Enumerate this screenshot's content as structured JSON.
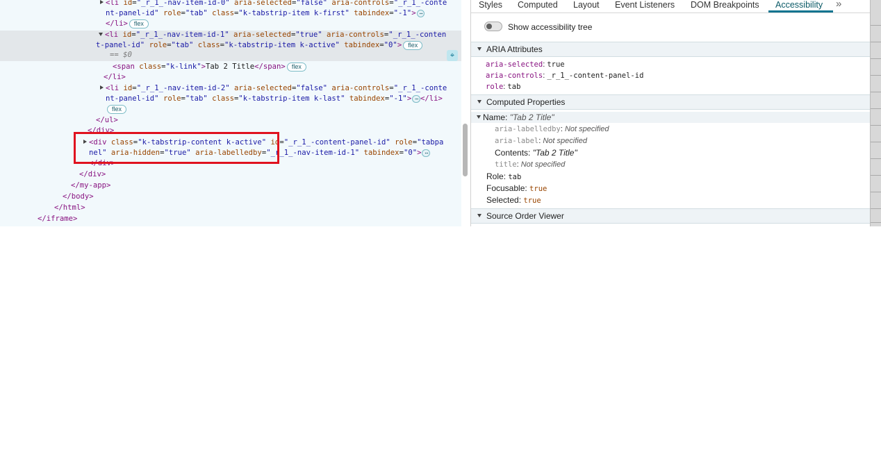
{
  "elements": {
    "lines": [
      {
        "pre": "<li id=\"_r_1_-nav-item-id-0\" aria-selected=\"false\" aria-controls=\"_r_1_-conte"
      },
      {
        "pre": "nt-panel-id\" role=\"tab\" class=\"k-tabstrip-item k-first\" tabindex=\"-1\">"
      },
      {
        "pre": "</li>"
      },
      {
        "pre": "<li id=\"_r_1_-nav-item-id-1\" aria-selected=\"true\" aria-controls=\"_r_1_-conten"
      },
      {
        "pre": "t-panel-id\" role=\"tab\" class=\"k-tabstrip-item k-active\" tabindex=\"0\">"
      },
      {
        "pre": "== $0"
      },
      {
        "pre": "<span class=\"k-link\">Tab 2 Title</span>"
      },
      {
        "pre": "</li>"
      },
      {
        "pre": "<li id=\"_r_1_-nav-item-id-2\" aria-selected=\"false\" aria-controls=\"_r_1_-conte"
      },
      {
        "pre": "nt-panel-id\" role=\"tab\" class=\"k-tabstrip-item k-last\" tabindex=\"-1\">…</li>"
      },
      {
        "pre": ""
      },
      {
        "pre": "</ul>"
      },
      {
        "pre": "</div>"
      },
      {
        "pre": "<div class=\"k-tabstrip-content k-active\" id=\"_r_1_-content-panel-id\" role=\"tabpa"
      },
      {
        "pre": "nel\" aria-hidden=\"true\" aria-labelledby=\"_r_1_-nav-item-id-1\" tabindex=\"0\">"
      },
      {
        "pre": "</div>"
      },
      {
        "pre": "</div>"
      },
      {
        "pre": "</my-app>"
      },
      {
        "pre": "</body>"
      },
      {
        "pre": "</html>"
      },
      {
        "pre": "</iframe>"
      }
    ],
    "badge_flex": "flex",
    "ellipsis": "⋯"
  },
  "sidebar": {
    "tabs": [
      "Styles",
      "Computed",
      "Layout",
      "Event Listeners",
      "DOM Breakpoints",
      "Accessibility"
    ],
    "active_tab": "Accessibility",
    "more_icon": "»",
    "toggle_label": "Show accessibility tree",
    "aria_header": "ARIA Attributes",
    "aria": [
      {
        "key": "aria-selected",
        "value": "true"
      },
      {
        "key": "aria-controls",
        "value": "_r_1_-content-panel-id"
      },
      {
        "key": "role",
        "value": "tab"
      }
    ],
    "computed_header": "Computed Properties",
    "name_label": "Name:",
    "name_value": "\"Tab 2 Title\"",
    "name_sources": [
      {
        "key": "aria-labelledby",
        "value": "Not specified"
      },
      {
        "key": "aria-label",
        "value": "Not specified"
      },
      {
        "key": "Contents",
        "value": "\"Tab 2 Title\""
      },
      {
        "key": "title",
        "value": "Not specified"
      }
    ],
    "computed": [
      {
        "key": "Role",
        "value": "tab"
      },
      {
        "key": "Focusable",
        "value": "true"
      },
      {
        "key": "Selected",
        "value": "true"
      }
    ],
    "source_order_header": "Source Order Viewer"
  }
}
